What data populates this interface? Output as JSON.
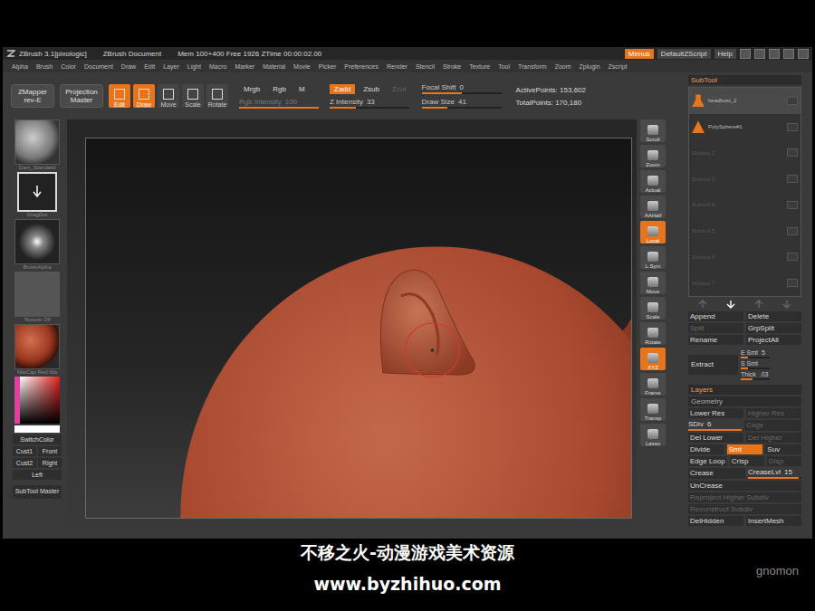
{
  "title_bar": {
    "app": "ZBrush 3.1[pixologic]",
    "document": "ZBrush Document",
    "stats": "Mem 100+400 Free 1926 ZTime 00:00:02.00",
    "buttons": [
      {
        "label": "Menus",
        "selected": true
      },
      {
        "label": "DefaultZScript",
        "selected": false
      },
      {
        "label": "Help",
        "selected": false
      }
    ]
  },
  "menu": [
    "Alpha",
    "Brush",
    "Color",
    "Document",
    "Draw",
    "Edit",
    "Layer",
    "Light",
    "Macro",
    "Marker",
    "Material",
    "Movie",
    "Picker",
    "Preferences",
    "Render",
    "Stencil",
    "Stroke",
    "Texture",
    "Tool",
    "Transform",
    "Zoom",
    "Zplugin",
    "Zscript"
  ],
  "toolbar": {
    "plugins": [
      "ZMapper rev-E",
      "Projection Master"
    ],
    "modes": [
      {
        "label": "Edit",
        "selected": true
      },
      {
        "label": "Draw",
        "selected": true
      },
      {
        "label": "Move",
        "selected": false
      },
      {
        "label": "Scale",
        "selected": false
      },
      {
        "label": "Rotate",
        "selected": false
      }
    ],
    "color_modes": [
      {
        "label": "Mrgb",
        "selected": false
      },
      {
        "label": "Rgb",
        "selected": false
      },
      {
        "label": "M",
        "selected": false
      }
    ],
    "rgb_intensity": {
      "label": "Rgb Intensity",
      "value": "100",
      "level": 1,
      "disabled": true
    },
    "z_modes": [
      {
        "label": "Zadd",
        "selected": true,
        "disabled": false
      },
      {
        "label": "Zsub",
        "selected": false,
        "disabled": false
      },
      {
        "label": "Zcut",
        "selected": false,
        "disabled": true
      }
    ],
    "z_intensity": {
      "label": "Z Intensity",
      "value": "33",
      "level": 0.33,
      "disabled": false
    },
    "focal_shift": {
      "label": "Focal Shift",
      "value": "0",
      "level": 0.5,
      "disabled": false
    },
    "draw_size": {
      "label": "Draw Size",
      "value": "41",
      "level": 0.32,
      "disabled": false
    },
    "points": [
      "ActivePoints: 153,602",
      "TotalPoints: 170,180"
    ]
  },
  "left_shelf": {
    "thumbs": [
      {
        "label": "Dam_Standard",
        "kind": "brush"
      },
      {
        "label": "DragDot",
        "kind": "stroke"
      },
      {
        "label": "BrushAlpha",
        "kind": "alpha"
      },
      {
        "label": "Texture Off",
        "kind": "texture"
      },
      {
        "label": "MatCap Red Wa",
        "kind": "material"
      }
    ],
    "color": "SwitchColor",
    "buttons": [
      [
        "Cust1",
        "Front"
      ],
      [
        "Cust2",
        "Right"
      ],
      [
        "Left"
      ]
    ],
    "master": "SubTool Master"
  },
  "right_shelf": [
    {
      "label": "Scroll",
      "selected": false
    },
    {
      "label": "Zoom",
      "selected": false
    },
    {
      "label": "Actual",
      "selected": false
    },
    {
      "label": "AAHalf",
      "selected": false
    },
    {
      "label": "Local",
      "selected": true
    },
    {
      "label": "L.Sym",
      "selected": false
    },
    {
      "label": "Move",
      "selected": false
    },
    {
      "label": "Scale",
      "selected": false
    },
    {
      "label": "Rotate",
      "selected": false
    },
    {
      "label": "XYZ",
      "selected": true
    },
    {
      "label": "Frame",
      "selected": false
    },
    {
      "label": "Transp",
      "selected": false
    },
    {
      "label": "Lasso",
      "selected": false
    }
  ],
  "subtool": {
    "title": "SubTool",
    "items": [
      {
        "label": "headbust_2",
        "selected": true,
        "empty": false
      },
      {
        "label": "PolySphere#1",
        "selected": false,
        "empty": false
      },
      {
        "label": "Subtool 2",
        "selected": false,
        "empty": true
      },
      {
        "label": "Subtool 3",
        "selected": false,
        "empty": true
      },
      {
        "label": "Subtool 4",
        "selected": false,
        "empty": true
      },
      {
        "label": "Subtool 5",
        "selected": false,
        "empty": true
      },
      {
        "label": "Subtool 6",
        "selected": false,
        "empty": true
      },
      {
        "label": "Subtool 7",
        "selected": false,
        "empty": true
      }
    ],
    "buttons": [
      [
        {
          "label": "Append",
          "disabled": false
        },
        {
          "label": "Delete",
          "disabled": false
        }
      ],
      [
        {
          "label": "Split",
          "disabled": true
        },
        {
          "label": "GrpSplit",
          "disabled": false
        }
      ],
      [
        {
          "label": "Rename",
          "disabled": false
        },
        {
          "label": "ProjectAll",
          "disabled": false
        }
      ]
    ],
    "extract": {
      "label": "Extract",
      "sliders": [
        {
          "label": "E Smt",
          "value": "5",
          "level": 0.25
        },
        {
          "label": "S Smt",
          "value": "",
          "level": 0.25
        },
        {
          "label": "Thick",
          "value": ".03",
          "level": 0.4
        }
      ]
    }
  },
  "layers": "Layers",
  "geometry": {
    "title": "Geometry",
    "rows": [
      [
        {
          "label": "Lower Res",
          "value": "",
          "kind": "button",
          "level": 0,
          "selected": false,
          "disabled": false
        },
        {
          "label": "Higher Res",
          "value": "",
          "kind": "button",
          "level": 0,
          "selected": false,
          "disabled": true
        }
      ],
      [
        {
          "label": "SDiv",
          "value": "6",
          "kind": "slider",
          "level": 1,
          "selected": false,
          "disabled": false
        },
        {
          "label": "Cage",
          "value": "",
          "kind": "button",
          "level": 0,
          "selected": false,
          "disabled": true
        }
      ],
      [
        {
          "label": "Del Lower",
          "value": "",
          "kind": "button",
          "level": 0,
          "selected": false,
          "disabled": false
        },
        {
          "label": "Del Higher",
          "value": "",
          "kind": "button",
          "level": 0,
          "selected": false,
          "disabled": true
        }
      ],
      [
        {
          "label": "Divide",
          "value": "",
          "kind": "button",
          "level": 0,
          "selected": false,
          "disabled": false
        },
        {
          "label": "Smt",
          "value": "",
          "kind": "button",
          "level": 0,
          "selected": true,
          "disabled": false
        },
        {
          "label": "Suv",
          "value": "",
          "kind": "button",
          "level": 0,
          "selected": false,
          "disabled": false
        }
      ],
      [
        {
          "label": "Edge Loop",
          "value": "",
          "kind": "button",
          "level": 0,
          "selected": false,
          "disabled": false
        },
        {
          "label": "Crisp",
          "value": "",
          "kind": "button",
          "level": 0,
          "selected": false,
          "disabled": false
        },
        {
          "label": "Disp",
          "value": "",
          "kind": "button",
          "level": 0,
          "selected": false,
          "disabled": true
        }
      ],
      [
        {
          "label": "Crease",
          "value": "",
          "kind": "button",
          "level": 0,
          "selected": false,
          "disabled": false
        },
        {
          "label": "CreaseLvl",
          "value": "15",
          "kind": "slider",
          "level": 0.95,
          "selected": false,
          "disabled": false
        }
      ],
      [
        {
          "label": "UnCrease",
          "value": "",
          "kind": "button",
          "level": 0,
          "selected": false,
          "disabled": false
        }
      ],
      [
        {
          "label": "Reproject Higher Subdiv",
          "value": "",
          "kind": "button",
          "level": 0,
          "selected": false,
          "disabled": true
        }
      ],
      [
        {
          "label": "Reconstruct Subdiv",
          "value": "",
          "kind": "button",
          "level": 0,
          "selected": false,
          "disabled": true
        }
      ],
      [
        {
          "label": "DelHidden",
          "value": "",
          "kind": "button",
          "level": 0,
          "selected": false,
          "disabled": false
        },
        {
          "label": "InsertMesh",
          "value": "",
          "kind": "button",
          "level": 0,
          "selected": false,
          "disabled": false
        }
      ]
    ]
  },
  "watermark": [
    "不移之火-动漫游戏美术资源",
    "www.byzhihuo.com"
  ],
  "logo": "gnomon"
}
